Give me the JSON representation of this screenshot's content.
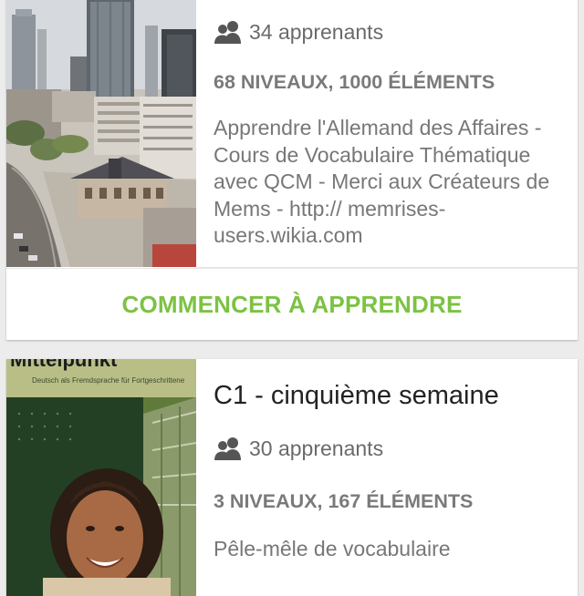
{
  "theme": {
    "accent": "#7cc243",
    "background": "#ececec",
    "card": "#ffffff"
  },
  "courses": [
    {
      "learners": "34 apprenants",
      "learners_icon": "users-icon",
      "stats": "68 NIVEAUX, 1000 ÉLÉMENTS",
      "description": "Apprendre l'Allemand des Affaires - Cours de Vocabulaire Thématique avec QCM - Merci aux Créateurs de Mems -  http:// memrises-users.wikia.com",
      "start_label": "COMMENCER À APPRENDRE",
      "thumbnail": "city-skyline-photo"
    },
    {
      "title": "C1 - cinquième semaine",
      "learners": "30 apprenants",
      "learners_icon": "users-icon",
      "stats": "3 NIVEAUX, 167 ÉLÉMENTS",
      "description": "Pêle-mêle de vocabulaire",
      "thumbnail": "textbook-cover-photo",
      "thumbnail_text": {
        "cover_title": "Mittelpunkt",
        "cover_subtitle": "Deutsch als Fremdsprache für Fortgeschrittene"
      }
    }
  ]
}
